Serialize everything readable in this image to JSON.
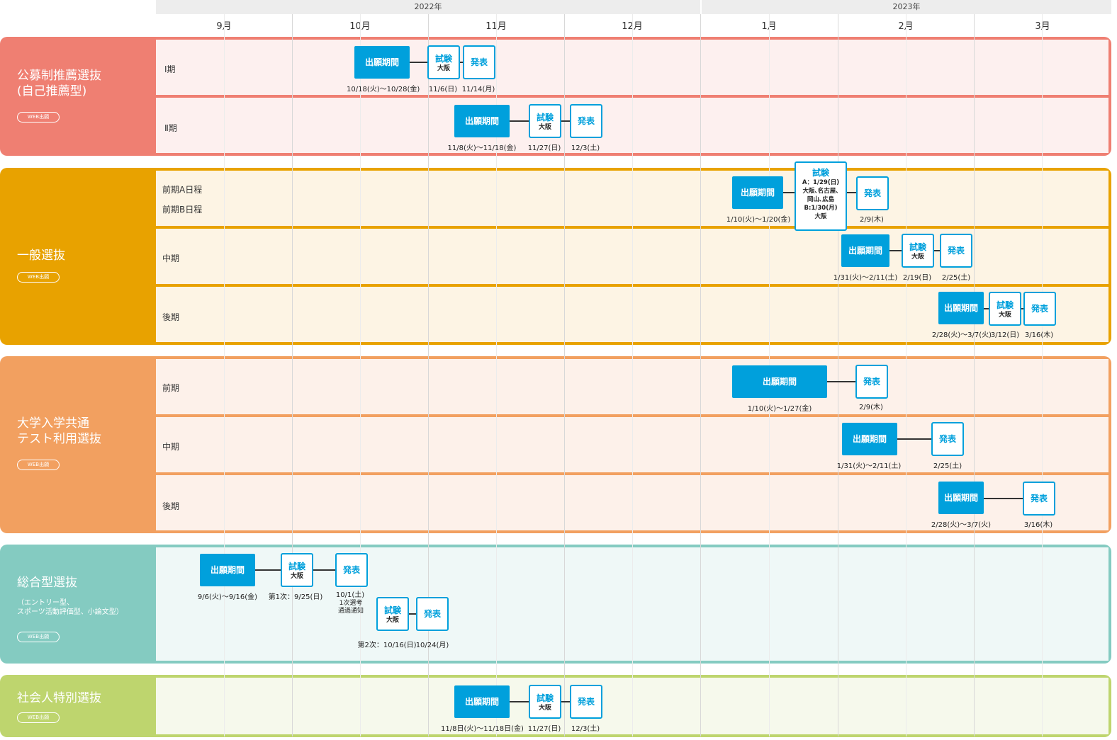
{
  "header": {
    "years": [
      "2022年",
      "2023年"
    ],
    "months": [
      "9月",
      "10月",
      "11月",
      "12月",
      "1月",
      "2月",
      "3月"
    ]
  },
  "colors": {
    "suisen": "#ef7f72",
    "ippan": "#e8a200",
    "kyotsu": "#f2a060",
    "sogo": "#84cbc1",
    "shakai": "#bed56e",
    "box": "#00a0dc"
  },
  "common": {
    "app_label": "出願期間",
    "exam_label": "試験",
    "osaka": "大阪",
    "announce_label": "発表",
    "web_label": "WEB出願"
  },
  "sections": [
    {
      "title": "公募制推薦選抜\n(自己推薦型)",
      "rows": [
        {
          "label": "Ⅰ期",
          "app_dates": "10/18(火)〜10/28(金)",
          "exam_date": "11/6(日)",
          "announce_date": "11/14(月)"
        },
        {
          "label": "Ⅱ期",
          "app_dates": "11/8(火)〜11/18(金)",
          "exam_date": "11/27(日)",
          "announce_date": "12/3(土)"
        }
      ]
    },
    {
      "title": "一般選抜",
      "rows": [
        {
          "label": "前期A日程",
          "label2": "前期B日程",
          "app_dates": "1/10(火)〜1/20(金)",
          "exam_detail": "A：1/29(日)\n大阪､名古屋､\n岡山､広島\nB:1/30(月)\n大阪",
          "announce_date": "2/9(木)"
        },
        {
          "label": "中期",
          "app_dates": "1/31(火)〜2/11(土)",
          "exam_date": "2/19(日)",
          "announce_date": "2/25(土)"
        },
        {
          "label": "後期",
          "app_dates": "2/28(火)〜3/7(火)",
          "exam_date": "3/12(日)",
          "announce_date": "3/16(木)"
        }
      ]
    },
    {
      "title": "大学入学共通\nテスト利用選抜",
      "rows": [
        {
          "label": "前期",
          "app_dates": "1/10(火)〜1/27(金)",
          "announce_date": "2/9(木)"
        },
        {
          "label": "中期",
          "app_dates": "1/31(火)〜2/11(土)",
          "announce_date": "2/25(土)"
        },
        {
          "label": "後期",
          "app_dates": "2/28(火)〜3/7(火)",
          "announce_date": "3/16(木)"
        }
      ]
    },
    {
      "title": "総合型選抜",
      "subtitle": "（エントリー型、\nスポーツ活動評価型、小論文型）",
      "app_dates": "9/6(火)〜9/16(金)",
      "exam1_date": "第1次：9/25(日)",
      "announce1_date": "10/1(土)",
      "announce1_note": "1次選考\n通過通知",
      "exam2_date": "第2次：10/16(日)",
      "announce2_date": "10/24(月)"
    },
    {
      "title": "社会人特別選抜",
      "app_dates": "11/8日(火)〜11/18日(金)",
      "exam_date": "11/27(日)",
      "announce_date": "12/3(土)"
    }
  ]
}
